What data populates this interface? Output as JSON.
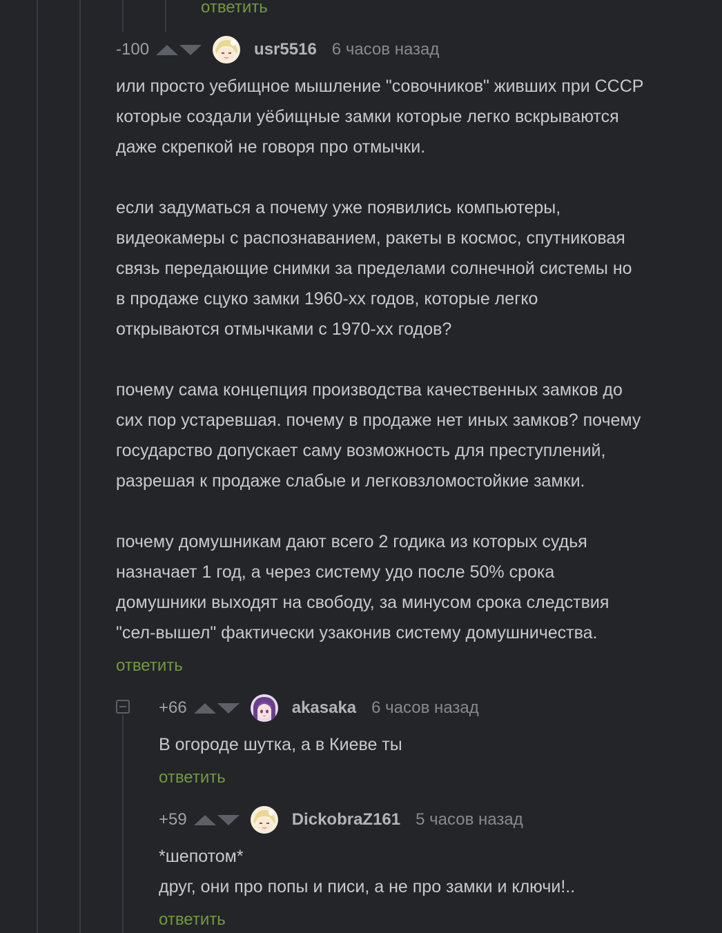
{
  "reply_label": "ответить",
  "comments": [
    {
      "rating": "-100",
      "username": "usr5516",
      "time": "6 часов назад",
      "avatar": "blonde-anime-avatar",
      "paragraphs": [
        [
          "или просто уебищное мышление \"совочников\" живших при СССР",
          "которые создали уёбищные замки которые легко вскрываются",
          "даже скрепкой не говоря про отмычки."
        ],
        [
          "если задуматься а почему уже появились компьютеры,",
          "видеокамеры с распознаванием, ракеты в космос, спутниковая",
          "связь передающие снимки за пределами солнечной системы но",
          "в продаже сцуко замки 1960-хх годов, которые легко",
          "открываются отмычками с 1970-хх годов?"
        ],
        [
          "почему сама концепция производства качественных замков до",
          "сих пор устаревшая. почему в продаже нет иных замков? почему",
          "государство допускает саму возможность для преступлений,",
          "разрешая к продаже слабые и легковзломостойкие замки."
        ],
        [
          "почему домушникам дают всего 2 годика из которых судья",
          "назначает 1 год, а через систему удо после 50% срока",
          "домушники выходят на свободу, за минусом срока следствия",
          "\"сел-вышел\" фактически узаконив систему домушничества."
        ]
      ]
    },
    {
      "rating": "+66",
      "username": "akasaka",
      "time": "6 часов назад",
      "avatar": "purple-hair-anime-avatar",
      "lines": [
        "В огороде шутка, а в Киеве ты"
      ]
    },
    {
      "rating": "+59",
      "username": "DickobraZ161",
      "time": "5 часов назад",
      "avatar": "blonde-anime-avatar",
      "lines": [
        "*шепотом*",
        "друг, они про попы и писи, а не про замки и ключи!.."
      ]
    }
  ],
  "colors": {
    "background": "#232529",
    "text": "#c8c9cb",
    "reply_link": "#73993f",
    "thread_line": "#383b40"
  }
}
